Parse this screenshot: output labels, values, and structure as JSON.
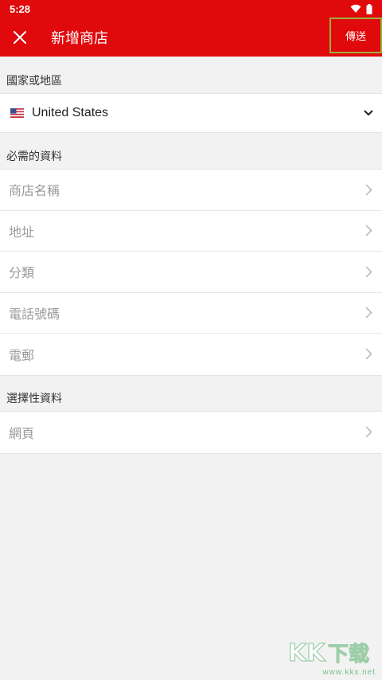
{
  "status_bar": {
    "time": "5:28",
    "icons": [
      "wifi-icon",
      "battery-icon"
    ]
  },
  "toolbar": {
    "title": "新增商店",
    "close_icon": "close-icon",
    "send_label": "傳送"
  },
  "country_section": {
    "header": "國家或地區",
    "country_flag": "us-flag-icon",
    "country_value": "United States",
    "dropdown_icon": "chevron-down-icon"
  },
  "required_section": {
    "header": "必需的資料",
    "items": [
      {
        "label": "商店名稱"
      },
      {
        "label": "地址"
      },
      {
        "label": "分類"
      },
      {
        "label": "電話號碼"
      },
      {
        "label": "電郵"
      }
    ]
  },
  "optional_section": {
    "header": "選擇性資料",
    "items": [
      {
        "label": "網頁"
      }
    ]
  },
  "watermark": {
    "logo_text": "KK下载",
    "url": "www.kkx.net"
  },
  "colors": {
    "brand_red": "#e0090c",
    "highlight_border": "#9bb03a",
    "background": "#f2f2f2"
  }
}
